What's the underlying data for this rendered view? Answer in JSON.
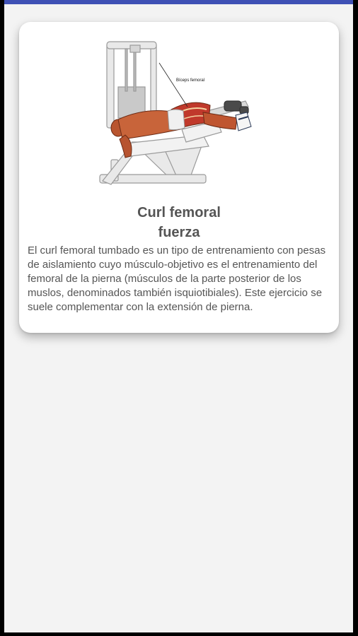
{
  "exercise": {
    "title_line1": "Curl femoral",
    "title_line2": "fuerza",
    "description": "El curl femoral tumbado es un tipo de entrenamiento con pesas de aislamiento cuyo músculo-objetivo es el entrenamiento del femoral de la pierna (músculos de la parte posterior de los muslos, denominados también isquiotibiales). Este ejercicio se suele complementar con la extensión de pierna.",
    "image_label": "Bíceps femoral"
  },
  "colors": {
    "accent": "#3f51b5",
    "card_background": "#ffffff",
    "screen_background": "#f3f3f3",
    "text": "#555555"
  }
}
